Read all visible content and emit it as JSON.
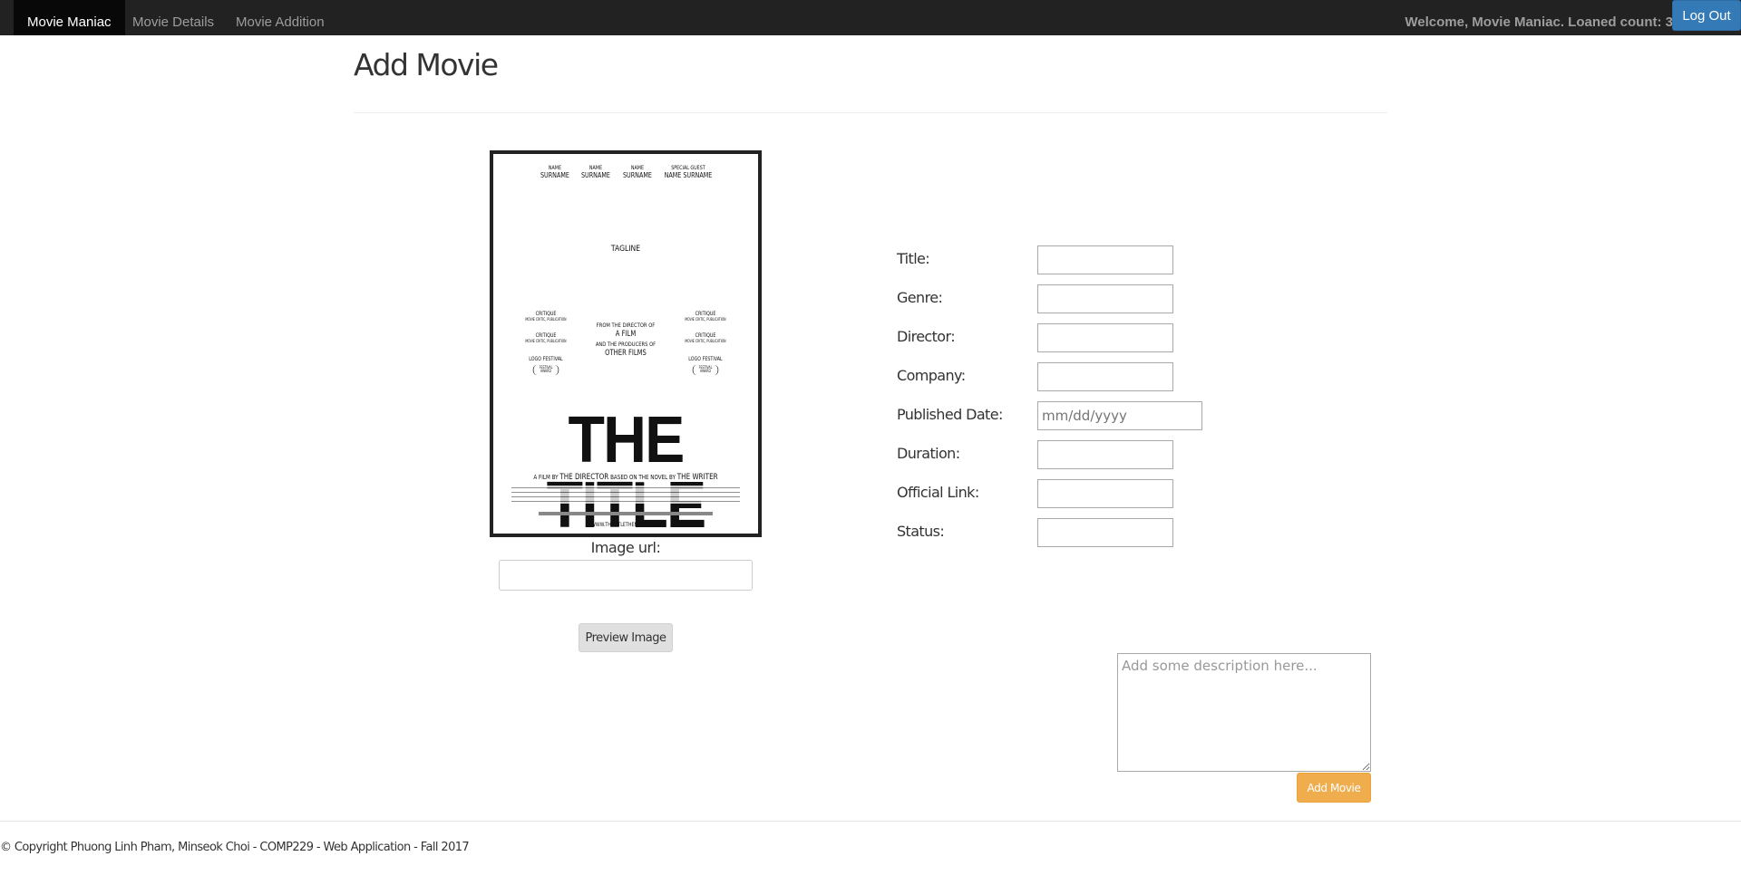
{
  "nav": {
    "brand": "Movie Maniac",
    "links": [
      "Movie Details",
      "Movie Addition"
    ],
    "welcome": "Welcome, Movie Maniac. Loaned count: 3",
    "logout_label": "Log Out"
  },
  "page": {
    "title": "Add Movie"
  },
  "poster": {
    "credits": [
      {
        "top": "NAME",
        "bottom": "SURNAME"
      },
      {
        "top": "NAME",
        "bottom": "SURNAME"
      },
      {
        "top": "NAME",
        "bottom": "SURNAME"
      },
      {
        "top": "SPECIAL GUEST",
        "bottom": "NAME SURNAME"
      }
    ],
    "tagline": "TAGLINE",
    "critique": "CRITIQUE",
    "critique_sub": "MOVIE CRITIC, PUBLICATION",
    "festival": "LOGO FESTIVAL",
    "festival_sub": "FESTIVAL AWARD",
    "center_1": "FROM THE DIRECTOR OF",
    "center_2": "A FILM",
    "center_3": "AND THE PRODUCERS OF",
    "center_4": "OTHER FILMS",
    "title": "THE TITLE",
    "byline_1": "A FILM BY",
    "byline_2": "THE DIRECTOR",
    "byline_3": "BASED ON THE NOVEL BY",
    "byline_4": "THE WRITER",
    "url": "WWW.THETITLETHEMOVIE.COM"
  },
  "image_url": {
    "label": "Image url:",
    "value": ""
  },
  "preview_label": "Preview Image",
  "form": {
    "title_label": "Title:",
    "genre_label": "Genre:",
    "director_label": "Director:",
    "company_label": "Company:",
    "published_label": "Published Date:",
    "published_placeholder": "mm/dd/yyyy",
    "duration_label": "Duration:",
    "link_label": "Official Link:",
    "status_label": "Status:"
  },
  "description": {
    "placeholder": "Add some description here..."
  },
  "add_label": "Add Movie",
  "footer": "© Copyright Phuong Linh Pham, Minseok Choi - COMP229 - Web Application - Fall 2017"
}
